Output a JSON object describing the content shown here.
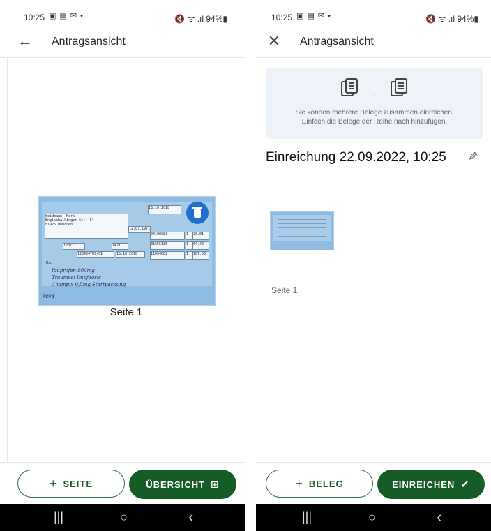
{
  "left_screen": {
    "status": {
      "time": "10:25",
      "indicators": "▣ ▤ ✉ •",
      "battery": "🔇 ᯤ .ıl 94%▮"
    },
    "appbar": {
      "title": "Antragsansicht",
      "nav_icon": "←"
    },
    "document": {
      "date1": "15.10.2018",
      "name": "Weidmann, Mark",
      "street": "Englschalkinger Str. 14",
      "city": "81925 München",
      "birth": "12.07.1971",
      "number1": "120771",
      "number2": "1421",
      "id": "123454789-01",
      "date2": "15.10.2018",
      "code1": "04190983",
      "code2": "01655136",
      "code3": "11054602",
      "qty": "1",
      "price1": "26.01",
      "price2": "64.49",
      "price3": "107.00",
      "rx": "Rp.",
      "handwriting": [
        "Ibuprofen 800mg",
        "Traumeel Impfdosis",
        "Champix 0,5mg Startpackung"
      ],
      "footer_left": "PKVd"
    },
    "page_label": "Seite 1",
    "buttons": {
      "add_page": "SEITE",
      "overview": "ÜBERSICHT",
      "overview_icon": "⊞"
    },
    "navbar": {
      "recent": "|||",
      "home": "○",
      "back": "‹"
    }
  },
  "right_screen": {
    "status": {
      "time": "10:25",
      "indicators": "▣ ▤ ✉ •",
      "battery": "🔇 ᯤ .ıl 94%▮"
    },
    "appbar": {
      "title": "Antragsansicht",
      "nav_icon": "✕"
    },
    "hint": {
      "line1": "Sie können mehrere Belege zusammen einreichen.",
      "line2": "Einfach die Belege der Reihe nach hinzufügen.",
      "plus": "+"
    },
    "submission_title": "Einreichung 22.09.2022, 10:25",
    "edit_icon": "✎",
    "thumb_label": "Seite 1",
    "buttons": {
      "add_receipt": "BELEG",
      "submit": "EINREICHEN",
      "submit_icon": "✔"
    },
    "navbar": {
      "recent": "|||",
      "home": "○",
      "back": "‹"
    }
  },
  "colors": {
    "primary_green": "#155c27",
    "accent_blue": "#1f6fd1",
    "hint_bg": "#edf3f9"
  }
}
